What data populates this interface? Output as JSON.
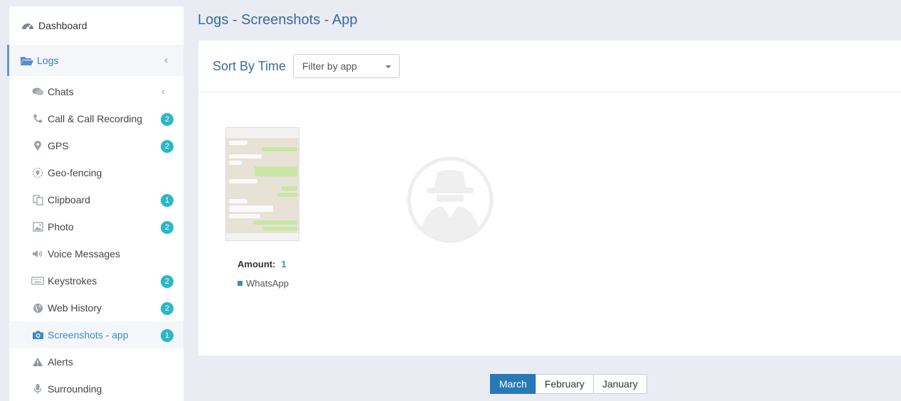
{
  "sidebar": {
    "dashboard": {
      "label": "Dashboard",
      "icon": "dashboard-icon"
    },
    "logs": {
      "label": "Logs",
      "icon": "folder-open-icon"
    },
    "items": [
      {
        "label": "Chats",
        "icon": "chat-icon",
        "badge": null,
        "chevron": true
      },
      {
        "label": "Call & Call Recording",
        "icon": "phone-icon",
        "badge": "2"
      },
      {
        "label": "GPS",
        "icon": "map-pin-icon",
        "badge": "2"
      },
      {
        "label": "Geo-fencing",
        "icon": "geofence-icon",
        "badge": null
      },
      {
        "label": "Clipboard",
        "icon": "clipboard-icon",
        "badge": "1"
      },
      {
        "label": "Photo",
        "icon": "photo-icon",
        "badge": "2"
      },
      {
        "label": "Voice Messages",
        "icon": "speaker-icon",
        "badge": null
      },
      {
        "label": "Keystrokes",
        "icon": "keyboard-icon",
        "badge": "2"
      },
      {
        "label": "Web History",
        "icon": "globe-icon",
        "badge": "2"
      },
      {
        "label": "Screenshots - app",
        "icon": "camera-icon",
        "badge": "1",
        "active": true
      },
      {
        "label": "Alerts",
        "icon": "warning-icon",
        "badge": null
      },
      {
        "label": "Surrounding",
        "icon": "microphone-icon",
        "badge": null
      }
    ]
  },
  "header": {
    "title": "Logs - Screenshots - App"
  },
  "toolbar": {
    "sort_label": "Sort By Time",
    "filter_value": "Filter by app"
  },
  "screenshot": {
    "amount_label": "Amount:",
    "amount_value": "1",
    "app_name": "WhatsApp"
  },
  "months": {
    "march": "March",
    "february": "February",
    "january": "January",
    "active": "March"
  },
  "colors": {
    "accent": "#2779b6",
    "badge": "#2bb7c9",
    "title": "#3a6b9c"
  }
}
